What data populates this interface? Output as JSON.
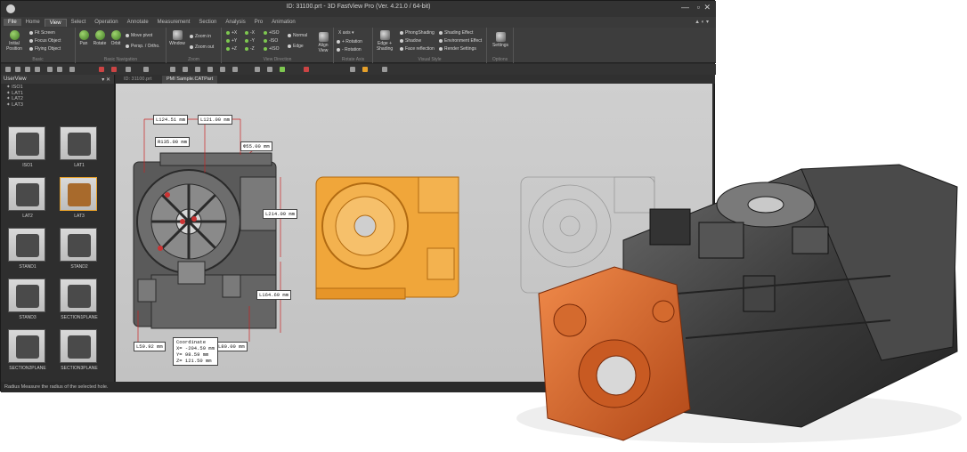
{
  "window": {
    "title": "ID: 31100.prt - 3D FastView Pro (Ver. 4.21.0 / 64-bit)",
    "controls": [
      "—",
      "▫",
      "✕"
    ]
  },
  "menu": {
    "file": "File",
    "tabs": [
      "Home",
      "View",
      "Select",
      "Operation",
      "Annotate",
      "Measurement",
      "Section",
      "Analysis",
      "Pro",
      "Animation"
    ],
    "active": "View",
    "right_controls": "▲  ◐ ▾"
  },
  "ribbon": {
    "basic": {
      "label": "Basic",
      "initial_position": "Initial Position",
      "fit_screen": "Fit Screen",
      "focus_object": "Focus Object",
      "flying_object": "Flying Object"
    },
    "basic_navigation": {
      "label": "Basic Navigation",
      "pan": "Pan",
      "rotate": "Rotate",
      "orbit": "Orbit",
      "move_pivot": "Move pivot",
      "persp_ortho": "Persp. / Ortho."
    },
    "zoom": {
      "label": "Zoom",
      "window": "Window",
      "zoom_in": "Zoom in",
      "zoom_out": "Zoom out"
    },
    "view_direction": {
      "label": "View Direction",
      "items": [
        "+X",
        "-X",
        "+ISO",
        "+Y",
        "-Y",
        "-ISO",
        "+Z",
        "-Z",
        "+ISO"
      ],
      "normal": "Normal",
      "edge": "Edge",
      "align_view": "Align View"
    },
    "rotate_axis": {
      "label": "Rotate Axis",
      "x_axis": "X axis",
      "plus_rotation": "+ Rotation",
      "minus_rotation": "- Rotation"
    },
    "visual_style": {
      "label": "Visual Style",
      "edge_shading": "Edge + Shading",
      "phong": "PhongShading",
      "shadow": "Shadow",
      "face_reflection": "Face reflection",
      "shading_effect": "Shading Effect",
      "environment_effect": "Environment Effect",
      "render_settings": "Render Settings"
    },
    "options": {
      "label": "Options",
      "settings": "Settings"
    }
  },
  "sidebar": {
    "title": "UserView",
    "tree": [
      "ISO1",
      "LAT1",
      "LAT2",
      "LAT3"
    ],
    "thumbnails": [
      "ISO1",
      "LAT1",
      "LAT2",
      "LAT3",
      "STAND1",
      "STAND2",
      "STAND3",
      "SECTION1PLANE",
      "SECTION2PLANE",
      "SECTION3PLANE"
    ],
    "selected": "LAT3"
  },
  "doc_tabs": [
    "ID: 31100.prt",
    "PMI Sample.CATPart"
  ],
  "dimensions": {
    "d1": "L124.51 mm",
    "d2": "L121.00 mm",
    "d3": "R135.00 mm",
    "d4": "Φ55.00 mm",
    "d5": "L214.09 mm",
    "d6": "L164.69 mm",
    "d7": "L59.92 mm",
    "d8": "L80.00 mm"
  },
  "coordinate": {
    "title": "Coordinate",
    "x": "X= -204.59 mm",
    "y": "Y= 98.59 mm",
    "z": "Z= 121.50 mm"
  },
  "status": "Radius   Measure the radius of the selected hole.",
  "colors": {
    "accent_orange": "#f0a63a",
    "highlight_orange": "#e06a2a"
  }
}
